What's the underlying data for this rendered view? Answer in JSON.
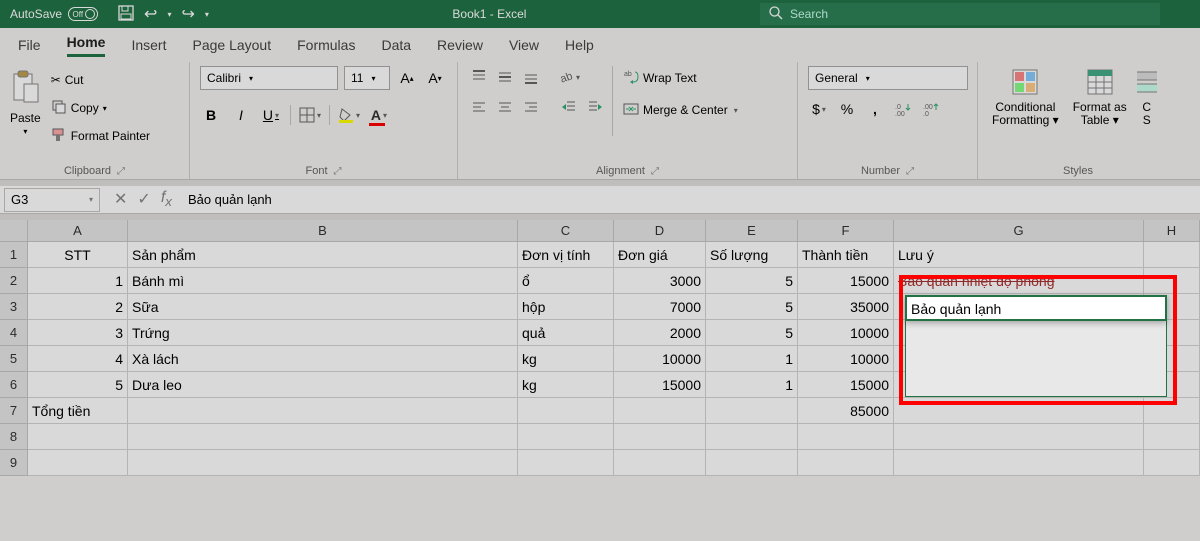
{
  "titlebar": {
    "autosave_label": "AutoSave",
    "autosave_state": "Off",
    "doc_title": "Book1  -  Excel",
    "search_placeholder": "Search"
  },
  "tabs": [
    "File",
    "Home",
    "Insert",
    "Page Layout",
    "Formulas",
    "Data",
    "Review",
    "View",
    "Help"
  ],
  "active_tab": "Home",
  "ribbon": {
    "clipboard": {
      "label": "Clipboard",
      "paste": "Paste",
      "cut": "Cut",
      "copy": "Copy",
      "fmtpainter": "Format Painter"
    },
    "font": {
      "label": "Font",
      "name": "Calibri",
      "size": "11",
      "bold": "B",
      "italic": "I",
      "underline": "U"
    },
    "alignment": {
      "label": "Alignment",
      "wrap": "Wrap Text",
      "merge": "Merge & Center"
    },
    "number": {
      "label": "Number",
      "format": "General",
      "currency": "$",
      "percent": "%",
      "comma": ","
    },
    "styles": {
      "label": "Styles",
      "cond": "Conditional\nFormatting",
      "fmtas": "Format as\nTable",
      "cell": "C\nS"
    }
  },
  "namebox": "G3",
  "formula": "Bảo quản lạnh",
  "columns": [
    "A",
    "B",
    "C",
    "D",
    "E",
    "F",
    "G",
    "H"
  ],
  "rows": [
    "1",
    "2",
    "3",
    "4",
    "5",
    "6",
    "7",
    "8",
    "9"
  ],
  "headers": {
    "A": "STT",
    "B": "Sản phẩm",
    "C": "Đơn vị tính",
    "D": "Đơn giá",
    "E": "Số lượng",
    "F": "Thành tiền",
    "G": "Lưu ý"
  },
  "data": [
    {
      "stt": "1",
      "sp": "Bánh mì",
      "dv": "ổ",
      "dg": "3000",
      "sl": "5",
      "tt": "15000",
      "ly": "Bảo quản nhiệt độ phòng"
    },
    {
      "stt": "2",
      "sp": "Sữa",
      "dv": "hộp",
      "dg": "7000",
      "sl": "5",
      "tt": "35000",
      "ly": "Bảo quản lạnh"
    },
    {
      "stt": "3",
      "sp": "Trứng",
      "dv": "quả",
      "dg": "2000",
      "sl": "5",
      "tt": "10000",
      "ly": ""
    },
    {
      "stt": "4",
      "sp": "Xà lách",
      "dv": "kg",
      "dg": "10000",
      "sl": "1",
      "tt": "10000",
      "ly": ""
    },
    {
      "stt": "5",
      "sp": "Dưa leo",
      "dv": "kg",
      "dg": "15000",
      "sl": "1",
      "tt": "15000",
      "ly": ""
    }
  ],
  "total": {
    "label": "Tổng tiền",
    "value": "85000"
  },
  "active_cell_text": "Bảo quản lạnh"
}
